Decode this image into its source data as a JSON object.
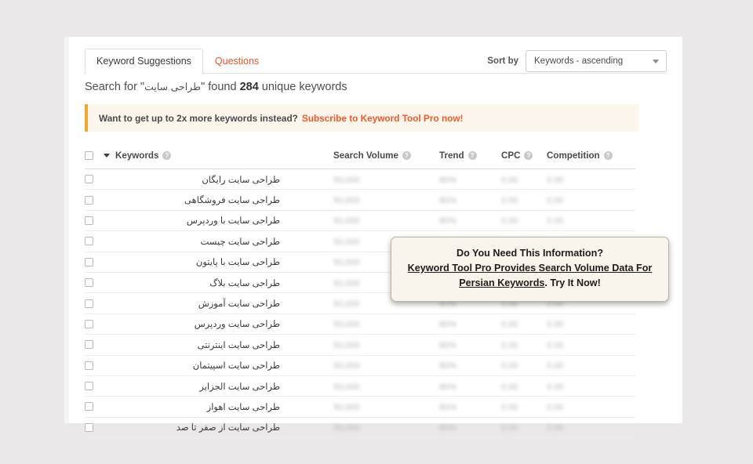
{
  "tabs": [
    {
      "label": "Keyword Suggestions",
      "active": true
    },
    {
      "label": "Questions",
      "active": false
    }
  ],
  "sort": {
    "label": "Sort by",
    "value": "Keywords - ascending",
    "caret_icon": "chevron-down-icon"
  },
  "summary": {
    "prefix": "Search for \"",
    "query": "طراحی سایت",
    "middle": "\" found ",
    "count": "284",
    "suffix": " unique keywords"
  },
  "promo": {
    "text": "Want to get up to 2x more keywords instead?",
    "link": "Subscribe to Keyword Tool Pro now!",
    "accent_color": "#f0a732",
    "link_color": "#f1592a",
    "background": "#fdf6ec"
  },
  "table": {
    "columns": [
      {
        "label": "Keywords",
        "help_icon": "help-circle-icon",
        "sorted": true,
        "sort_icon": "sort-descending-arrow-icon"
      },
      {
        "label": "Search Volume",
        "help_icon": "help-circle-icon"
      },
      {
        "label": "Trend",
        "help_icon": "help-circle-icon"
      },
      {
        "label": "CPC",
        "help_icon": "help-circle-icon"
      },
      {
        "label": "Competition",
        "help_icon": "help-circle-icon"
      }
    ],
    "masked": {
      "volume": "50,000",
      "trend": "80%",
      "cpc": "0.00",
      "competition": "0.00"
    },
    "rows": [
      {
        "keyword": "طراحی سایت رایگان"
      },
      {
        "keyword": "طراحی سایت فروشگاهی"
      },
      {
        "keyword": "طراحی سایت با وردپرس"
      },
      {
        "keyword": "طراحی سایت چیست"
      },
      {
        "keyword": "طراحی سایت با پایتون"
      },
      {
        "keyword": "طراحی سایت بلاگ"
      },
      {
        "keyword": "طراحی سایت آموزش"
      },
      {
        "keyword": "طراحی سایت وردپرس"
      },
      {
        "keyword": "طراحی سایت اینترنتی"
      },
      {
        "keyword": "طراحی سایت اسپیتمان"
      },
      {
        "keyword": "طراحی سایت الجزایر"
      },
      {
        "keyword": "طراحی سایت اهواز"
      },
      {
        "keyword": "طراحی سایت از صفر تا صد"
      }
    ]
  },
  "popup": {
    "title": "Do You Need This Information?",
    "link": "Keyword Tool Pro Provides Search Volume Data For Persian Keywords",
    "tail": ". Try It Now!",
    "background": "#faf5ec"
  }
}
